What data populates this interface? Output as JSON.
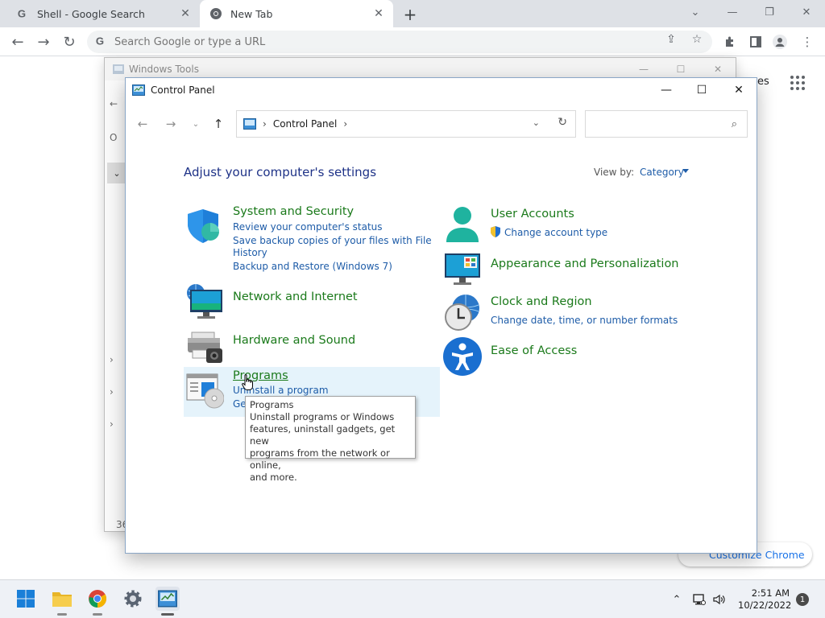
{
  "chrome": {
    "tabs": [
      {
        "title": "Shell - Google Search",
        "favicon": "google-g-icon"
      },
      {
        "title": "New Tab",
        "favicon": "chrome-icon"
      }
    ],
    "omnibox_placeholder": "Search Google or type a URL",
    "page": {
      "images_link": "es",
      "customize_label": "Customize Chrome"
    }
  },
  "windows_tools": {
    "title": "Windows Tools",
    "side_labels": [
      "O",
      "36"
    ]
  },
  "control_panel": {
    "title": "Control Panel",
    "address": {
      "segment": "Control Panel"
    },
    "heading": "Adjust your computer's settings",
    "view_by_label": "View by:",
    "view_by_value": "Category",
    "categories_left": [
      {
        "title": "System and Security",
        "links": [
          "Review your computer's status",
          "Save backup copies of your files with File",
          "History",
          "Backup and Restore (Windows 7)"
        ]
      },
      {
        "title": "Network and Internet",
        "links": []
      },
      {
        "title": "Hardware and Sound",
        "links": []
      },
      {
        "title": "Programs",
        "links": [
          "Uninstall a program",
          "Ge"
        ]
      }
    ],
    "categories_right": [
      {
        "title": "User Accounts",
        "links": [
          "Change account type"
        ]
      },
      {
        "title": "Appearance and Personalization",
        "links": []
      },
      {
        "title": "Clock and Region",
        "links": [
          "Change date, time, or number formats"
        ]
      },
      {
        "title": "Ease of Access",
        "links": []
      }
    ],
    "tooltip": {
      "title": "Programs",
      "lines": [
        "Uninstall programs or Windows",
        "features, uninstall gadgets, get new",
        "programs from the network or online,",
        "and more."
      ]
    }
  },
  "taskbar": {
    "apps": [
      "windows-start-icon",
      "file-explorer-icon",
      "chrome-icon",
      "settings-gear-icon",
      "control-panel-icon"
    ],
    "clock_time": "2:51 AM",
    "clock_date": "10/22/2022",
    "notification_count": "1"
  },
  "colors": {
    "cp_heading": "#1e3287",
    "cp_category_title": "#1b7a1b",
    "cp_link": "#1e5ca8",
    "programs_hover": "#e5f3fb"
  }
}
